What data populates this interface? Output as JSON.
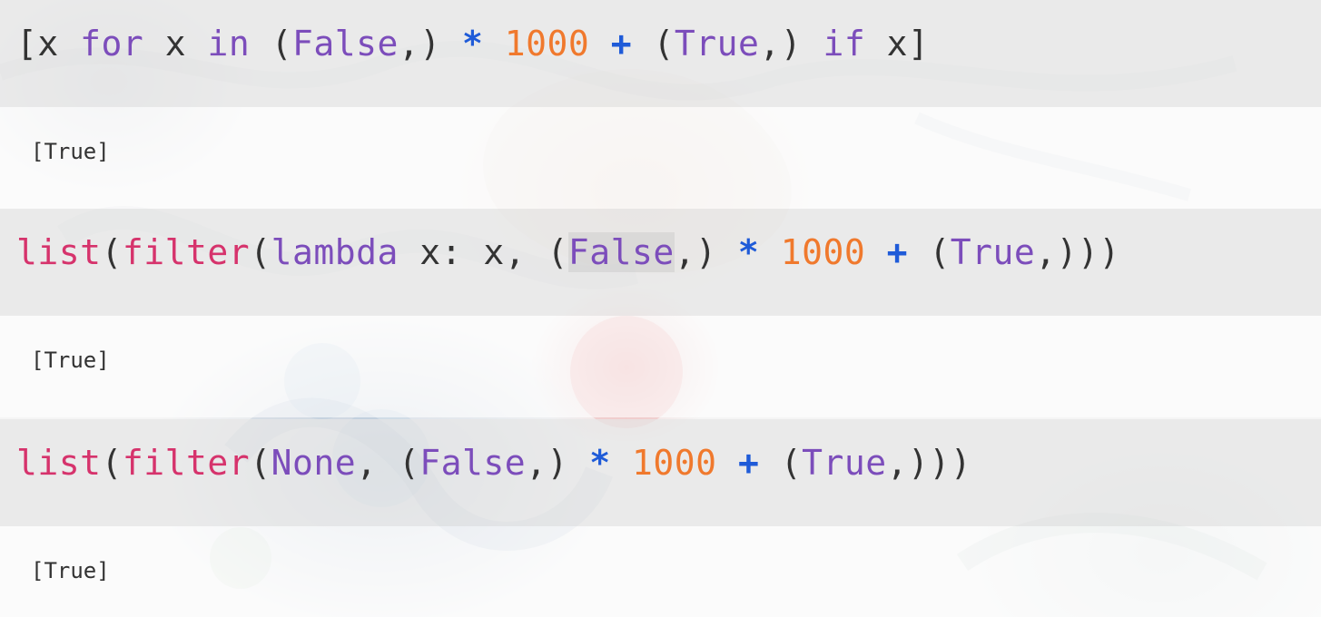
{
  "cells": [
    {
      "input_tokens": [
        {
          "text": "[",
          "cls": "plain"
        },
        {
          "text": "x",
          "cls": "plain"
        },
        {
          "text": " ",
          "cls": "plain"
        },
        {
          "text": "for",
          "cls": "kw"
        },
        {
          "text": " x ",
          "cls": "plain"
        },
        {
          "text": "in",
          "cls": "kw"
        },
        {
          "text": " (",
          "cls": "plain"
        },
        {
          "text": "False",
          "cls": "kw"
        },
        {
          "text": ",) ",
          "cls": "plain"
        },
        {
          "text": "*",
          "cls": "op"
        },
        {
          "text": " ",
          "cls": "plain"
        },
        {
          "text": "1000",
          "cls": "num"
        },
        {
          "text": " ",
          "cls": "plain"
        },
        {
          "text": "+",
          "cls": "op"
        },
        {
          "text": " (",
          "cls": "plain"
        },
        {
          "text": "True",
          "cls": "kw"
        },
        {
          "text": ",) ",
          "cls": "plain"
        },
        {
          "text": "if",
          "cls": "kw"
        },
        {
          "text": " x]",
          "cls": "plain"
        }
      ],
      "output": "[True]"
    },
    {
      "input_tokens": [
        {
          "text": "list",
          "cls": "fn"
        },
        {
          "text": "(",
          "cls": "plain"
        },
        {
          "text": "filter",
          "cls": "fn"
        },
        {
          "text": "(",
          "cls": "plain"
        },
        {
          "text": "lambda",
          "cls": "kw"
        },
        {
          "text": " x: x, (",
          "cls": "plain"
        },
        {
          "text": "False",
          "cls": "kw hl-false"
        },
        {
          "text": ",) ",
          "cls": "plain"
        },
        {
          "text": "*",
          "cls": "op"
        },
        {
          "text": " ",
          "cls": "plain"
        },
        {
          "text": "1000",
          "cls": "num"
        },
        {
          "text": " ",
          "cls": "plain"
        },
        {
          "text": "+",
          "cls": "op"
        },
        {
          "text": " (",
          "cls": "plain"
        },
        {
          "text": "True",
          "cls": "kw"
        },
        {
          "text": ",)))",
          "cls": "plain"
        }
      ],
      "output": "[True]"
    },
    {
      "input_tokens": [
        {
          "text": "list",
          "cls": "fn"
        },
        {
          "text": "(",
          "cls": "plain"
        },
        {
          "text": "filter",
          "cls": "fn"
        },
        {
          "text": "(",
          "cls": "plain"
        },
        {
          "text": "None",
          "cls": "kw"
        },
        {
          "text": ", (",
          "cls": "plain"
        },
        {
          "text": "False",
          "cls": "kw"
        },
        {
          "text": ",) ",
          "cls": "plain"
        },
        {
          "text": "*",
          "cls": "op"
        },
        {
          "text": " ",
          "cls": "plain"
        },
        {
          "text": "1000",
          "cls": "num"
        },
        {
          "text": " ",
          "cls": "plain"
        },
        {
          "text": "+",
          "cls": "op"
        },
        {
          "text": " (",
          "cls": "plain"
        },
        {
          "text": "True",
          "cls": "kw"
        },
        {
          "text": ",)))",
          "cls": "plain"
        }
      ],
      "output": "[True]"
    }
  ],
  "colors": {
    "keyword": "#7c4dbb",
    "function": "#d6336c",
    "number": "#f0792d",
    "operator": "#1f5bd8",
    "text": "#333333",
    "input_background": "#e6e6e6",
    "output_background": "#ffffff"
  }
}
